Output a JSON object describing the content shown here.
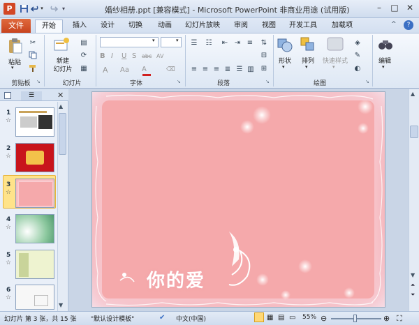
{
  "titlebar": {
    "title": "婚纱相册.ppt [兼容模式] - Microsoft PowerPoint 非商业用途 (试用版)",
    "app_icon": "P",
    "minimize": "–",
    "restore": "□",
    "close": "✕",
    "help": "?",
    "ribbon_min": "^"
  },
  "tabs": [
    "开始",
    "插入",
    "设计",
    "切换",
    "动画",
    "幻灯片放映",
    "审阅",
    "视图",
    "开发工具",
    "加载项"
  ],
  "file_tab": "文件",
  "ribbon": {
    "groups": {
      "clipboard": "剪贴板",
      "slides": "幻灯片",
      "font": "字体",
      "paragraph": "段落",
      "drawing": "绘图"
    },
    "paste": "粘贴",
    "new_slide_line1": "新建",
    "new_slide_line2": "幻灯片",
    "shape": "形状",
    "arrange": "排列",
    "quick_styles": "快速样式",
    "editing": "编辑",
    "font_buttons": [
      "B",
      "I",
      "U",
      "S",
      "abc",
      "AV",
      "Aa"
    ],
    "font_size_buttons": [
      "A",
      "A"
    ]
  },
  "slides": [
    {
      "num": "1",
      "star": "☆"
    },
    {
      "num": "2",
      "star": "☆"
    },
    {
      "num": "3",
      "star": "☆"
    },
    {
      "num": "4",
      "star": "☆"
    },
    {
      "num": "5",
      "star": "☆"
    },
    {
      "num": "6",
      "star": "☆"
    }
  ],
  "slide_text": "你的爱",
  "statusbar": {
    "slide_info": "幻灯片 第 3 张，共 15 张",
    "theme": "\"默认设计模板\"",
    "language": "中文(中国)",
    "zoom": "55%"
  },
  "colors": {
    "file_tab": "#d24726",
    "slide_pink": "#f5a9ab",
    "selection": "#ffe38a"
  }
}
